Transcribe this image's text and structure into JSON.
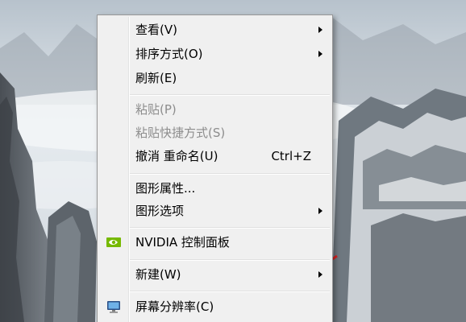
{
  "menu": {
    "items": [
      {
        "label": "查看(V)",
        "shortcut": "",
        "submenu": true,
        "disabled": false,
        "icon": ""
      },
      {
        "label": "排序方式(O)",
        "shortcut": "",
        "submenu": true,
        "disabled": false,
        "icon": ""
      },
      {
        "label": "刷新(E)",
        "shortcut": "",
        "submenu": false,
        "disabled": false,
        "icon": ""
      },
      {
        "label": "粘贴(P)",
        "shortcut": "",
        "submenu": false,
        "disabled": true,
        "icon": ""
      },
      {
        "label": "粘贴快捷方式(S)",
        "shortcut": "",
        "submenu": false,
        "disabled": true,
        "icon": ""
      },
      {
        "label": "撤消 重命名(U)",
        "shortcut": "Ctrl+Z",
        "submenu": false,
        "disabled": false,
        "icon": ""
      },
      {
        "label": "图形属性...",
        "shortcut": "",
        "submenu": false,
        "disabled": false,
        "icon": ""
      },
      {
        "label": "图形选项",
        "shortcut": "",
        "submenu": true,
        "disabled": false,
        "icon": ""
      },
      {
        "label": "NVIDIA 控制面板",
        "shortcut": "",
        "submenu": false,
        "disabled": false,
        "icon": "nvidia-icon"
      },
      {
        "label": "新建(W)",
        "shortcut": "",
        "submenu": true,
        "disabled": false,
        "icon": ""
      },
      {
        "label": "屏幕分辨率(C)",
        "shortcut": "",
        "submenu": false,
        "disabled": false,
        "icon": "monitor-icon"
      }
    ]
  },
  "colors": {
    "arrow_annotation": "#e02020",
    "menu_background": "#f0f0f0",
    "disabled_text": "#8d8d8d",
    "nvidia_green": "#76b900"
  }
}
